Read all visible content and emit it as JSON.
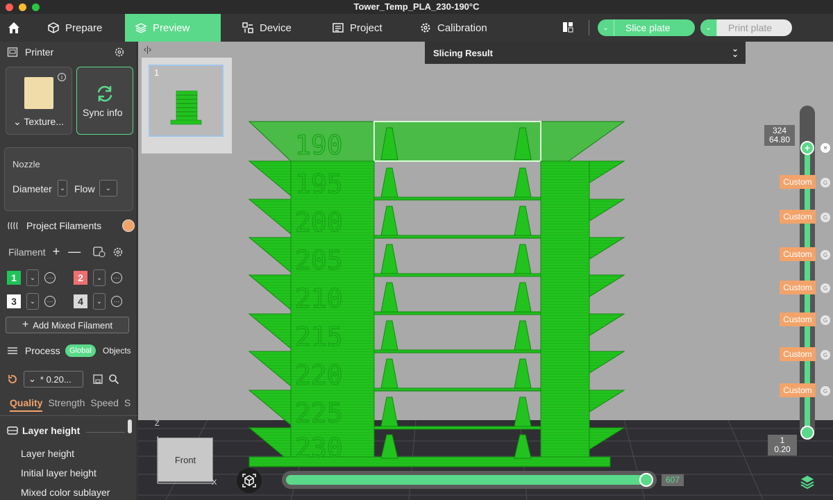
{
  "window": {
    "title": "Tower_Temp_PLA_230-190°C"
  },
  "toolbar": {
    "prepare": "Prepare",
    "preview": "Preview",
    "device": "Device",
    "project": "Project",
    "calibration": "Calibration",
    "slice_plate": "Slice plate",
    "print_plate": "Print plate"
  },
  "sidebar": {
    "printer": {
      "title": "Printer",
      "texture": "Texture...",
      "sync": "Sync info"
    },
    "nozzle": {
      "title": "Nozzle",
      "diameter": "Diameter",
      "flow": "Flow"
    },
    "filaments": {
      "title": "Project Filaments",
      "label": "Filament",
      "slots": [
        {
          "num": "1",
          "color": "#22c25a"
        },
        {
          "num": "2",
          "color": "#f07070"
        },
        {
          "num": "3",
          "color": "#ffffff"
        },
        {
          "num": "4",
          "color": "#d9d9d9"
        }
      ],
      "add_mixed": "Add Mixed Filament"
    },
    "process": {
      "title": "Process",
      "global": "Global",
      "objects": "Objects",
      "preset": "* 0.20...",
      "tabs": [
        "Quality",
        "Strength",
        "Speed",
        "S"
      ],
      "section": "Layer height",
      "params": [
        "Layer height",
        "Initial layer height",
        "Mixed color sublayer"
      ]
    }
  },
  "viewport": {
    "plate_number": "1",
    "slicing_result": "Slicing Result",
    "custom_label": "Custom",
    "top_layer": "324",
    "top_height": "64.80",
    "bottom_layer": "1",
    "bottom_height": "0.20",
    "move_value": "607",
    "front_label": "Front",
    "axis_z": "Z",
    "axis_x": "X",
    "tower_temps": [
      "190",
      "195",
      "200",
      "205",
      "210",
      "215",
      "220",
      "225",
      "230"
    ]
  },
  "colors": {
    "accent": "#5ad98a",
    "custom_tag": "#f3a36a",
    "model": "#22c31e"
  }
}
